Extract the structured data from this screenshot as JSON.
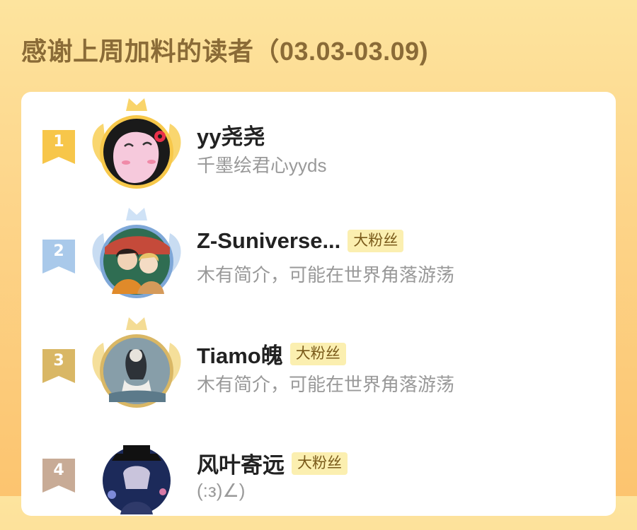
{
  "title": "感谢上周加料的读者（03.03-03.09)",
  "readers": [
    {
      "rank": "1",
      "name": "yy尧尧",
      "badge": "",
      "bio": "千墨绘君心yyds"
    },
    {
      "rank": "2",
      "name": "Z-Suniverse...",
      "badge": "大粉丝",
      "bio": "木有简介，可能在世界角落游荡"
    },
    {
      "rank": "3",
      "name": "Tiamo魄",
      "badge": "大粉丝",
      "bio": "木有简介，可能在世界角落游荡"
    },
    {
      "rank": "4",
      "name": "风叶寄远",
      "badge": "大粉丝",
      "bio": "(:з)∠)"
    }
  ],
  "colors": {
    "gold": "#f7c64a",
    "silver": "#a9c9ea",
    "bronze": "#d9b765",
    "rank4": "#c8ab96",
    "title": "#8a6b37",
    "badge_bg": "#fbefb0"
  },
  "icons": [
    "crown-icon",
    "wing-icon",
    "rank-flag-icon"
  ]
}
